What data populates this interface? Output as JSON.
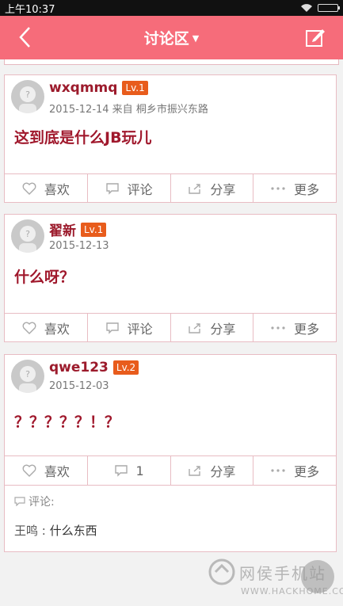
{
  "status_bar": {
    "time": "上午10:37"
  },
  "header": {
    "title": "讨论区",
    "back_icon": "back-arrow-icon",
    "edit_icon": "edit-icon"
  },
  "posts": [
    {
      "username": "wxqmmq",
      "level": "Lv.1",
      "meta": "2015-12-14  来自  桐乡市振兴东路",
      "content": "这到底是什么JB玩儿",
      "actions": {
        "like": "喜欢",
        "comment": "评论",
        "share": "分享",
        "more": "更多"
      }
    },
    {
      "username": "翟新",
      "level": "Lv.1",
      "meta": "2015-12-13",
      "content": "什么呀？",
      "actions": {
        "like": "喜欢",
        "comment": "评论",
        "share": "分享",
        "more": "更多"
      }
    },
    {
      "username": "qwe123",
      "level": "Lv.2",
      "meta": "2015-12-03",
      "content": "？？？？？！？",
      "actions": {
        "like": "喜欢",
        "comment": "1",
        "share": "分享",
        "more": "更多"
      },
      "comments_label": "评论:",
      "comments": [
        {
          "author": "王鸣",
          "text": "什么东西"
        }
      ]
    }
  ],
  "watermark": {
    "title": "网侯手机站",
    "url": "WWW.HACKHOME.COM"
  },
  "colors": {
    "header_bg": "#f66c7a",
    "username": "#9c1b2c",
    "content": "#a0182c",
    "level_badge": "#e85c1c"
  }
}
